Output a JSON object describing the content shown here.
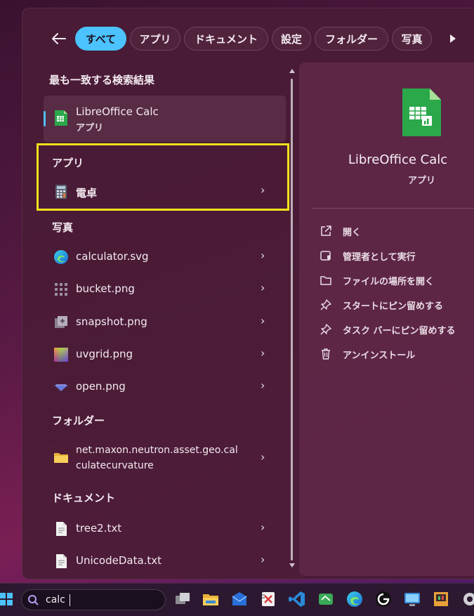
{
  "filters": [
    "すべて",
    "アプリ",
    "ドキュメント",
    "設定",
    "フォルダー",
    "写真"
  ],
  "best_match": {
    "heading": "最も一致する検索結果",
    "name": "LibreOffice Calc",
    "type": "アプリ"
  },
  "apps": {
    "heading": "アプリ",
    "items": [
      {
        "label": "電卓"
      }
    ]
  },
  "photos": {
    "heading": "写真",
    "items": [
      {
        "label": "calculator.svg"
      },
      {
        "label": "bucket.png"
      },
      {
        "label": "snapshot.png"
      },
      {
        "label": "uvgrid.png"
      },
      {
        "label": "open.png"
      }
    ]
  },
  "folders": {
    "heading": "フォルダー",
    "items": [
      {
        "label_line1": "net.maxon.neutron.asset.geo.cal",
        "label_line2": "culatecurvature"
      }
    ]
  },
  "documents": {
    "heading": "ドキュメント",
    "items": [
      {
        "label": "tree2.txt"
      },
      {
        "label": "UnicodeData.txt"
      }
    ]
  },
  "detail": {
    "name": "LibreOffice Calc",
    "type": "アプリ",
    "actions": [
      {
        "label": "開く",
        "icon": "open-external-icon"
      },
      {
        "label": "管理者として実行",
        "icon": "admin-shield-icon"
      },
      {
        "label": "ファイルの場所を開く",
        "icon": "folder-icon"
      },
      {
        "label": "スタートにピン留めする",
        "icon": "pin-icon"
      },
      {
        "label": "タスク バーにピン留めする",
        "icon": "pin-icon"
      },
      {
        "label": "アンインストール",
        "icon": "trash-icon"
      }
    ]
  },
  "taskbar": {
    "search_value": "calc"
  },
  "colors": {
    "accent": "#4cc2ff",
    "highlight_box": "#f2e21a",
    "calc_green": "#2aa84a"
  }
}
